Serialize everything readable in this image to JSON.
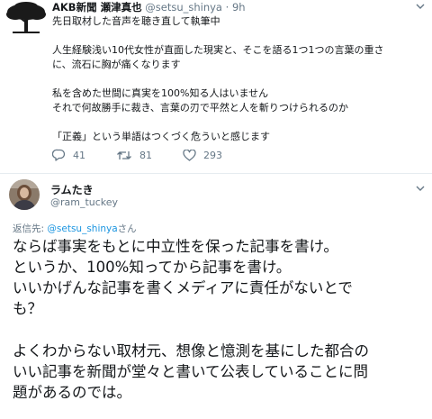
{
  "tweet": {
    "author_name": "AKB新聞 瀬津真也",
    "handle": "@setsu_shinya",
    "separator": "·",
    "time": "9h",
    "lines": [
      "先日取材した音声を聴き直して執筆中",
      "",
      "人生経験浅い10代女性が直面した現実と、そこを語る1つ1つの言葉の重さ",
      "に、流石に胸が痛くなります",
      "",
      "私を含めた世間に真実を100%知る人はいません",
      "それで何故勝手に裁き、言葉の刃で平然と人を斬りつけられるのか",
      "",
      "「正義」という単語はつくづく危ういと感じます"
    ],
    "actions": {
      "replies": "41",
      "retweets": "81",
      "likes": "293"
    }
  },
  "reply": {
    "author_name": "ラムたき",
    "handle": "@ram_tuckey",
    "replying_prefix": "返信先: ",
    "replying_mention": "@setsu_shinya",
    "replying_suffix": "さん",
    "lines": [
      "ならば事実をもとに中立性を保った記事を書け。",
      "というか、100%知ってから記事を書け。",
      "いいかげんな記事を書くメディアに責任がないとで",
      "も？",
      "",
      "よくわからない取材元、想像と憶測を基にした都合の",
      "いい記事を新聞が堂々と書いて公表していることに問",
      "題があるのでは。"
    ]
  },
  "icons": {
    "avatar1": "tree-avatar-icon",
    "avatar2": "person-avatar-icon",
    "reply": "reply-icon",
    "retweet": "retweet-icon",
    "like": "heart-icon",
    "menu": "chevron-down-icon"
  },
  "colors": {
    "text": "#14171a",
    "secondary": "#657786",
    "link": "#1b95e0",
    "divider": "#e6ecf0"
  }
}
